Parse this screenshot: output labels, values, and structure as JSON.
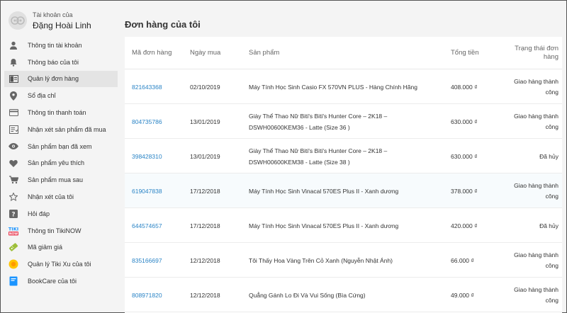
{
  "account": {
    "subtitle": "Tài khoản của",
    "name": "Đặng Hoài Linh"
  },
  "menu": [
    {
      "label": "Thông tin tài khoản",
      "icon": "user-icon"
    },
    {
      "label": "Thông báo của tôi",
      "icon": "bell-icon"
    },
    {
      "label": "Quản lý đơn hàng",
      "icon": "orders-icon",
      "active": true
    },
    {
      "label": "Sổ địa chỉ",
      "icon": "location-pin-icon"
    },
    {
      "label": "Thông tin thanh toán",
      "icon": "credit-card-icon"
    },
    {
      "label": "Nhận xét sản phẩm đã mua",
      "icon": "review-list-icon"
    },
    {
      "label": "Sản phẩm bạn đã xem",
      "icon": "eye-icon"
    },
    {
      "label": "Sản phẩm yêu thích",
      "icon": "heart-icon"
    },
    {
      "label": "Sản phẩm mua sau",
      "icon": "cart-icon"
    },
    {
      "label": "Nhận xét của tôi",
      "icon": "star-icon"
    },
    {
      "label": "Hỏi đáp",
      "icon": "question-icon"
    },
    {
      "label": "Thông tin TikiNOW",
      "icon": "tikinow-icon"
    },
    {
      "label": "Mã giảm giá",
      "icon": "coupon-icon"
    },
    {
      "label": "Quản lý Tiki Xu của tôi",
      "icon": "tiki-xu-coin-icon"
    },
    {
      "label": "BookCare của tôi",
      "icon": "bookcare-icon"
    }
  ],
  "page": {
    "title": "Đơn hàng của tôi"
  },
  "table": {
    "headers": {
      "id": "Mã đơn hàng",
      "date": "Ngày mua",
      "product": "Sản phẩm",
      "total": "Tổng tiền",
      "status": "Trạng thái đơn hàng"
    },
    "rows": [
      {
        "id": "821643368",
        "date": "02/10/2019",
        "product": "Máy Tính Học Sinh Casio FX 570VN PLUS - Hàng Chính Hãng",
        "total": "408.000 ₫",
        "status": "Giao hàng thành công"
      },
      {
        "id": "804735786",
        "date": "13/01/2019",
        "product": "Giày Thể Thao Nữ Biti's Biti's Hunter Core – 2K18 – DSWH00600KEM36 - Latte (Size 36 )",
        "total": "630.000 ₫",
        "status": "Giao hàng thành công"
      },
      {
        "id": "398428310",
        "date": "13/01/2019",
        "product": "Giày Thể Thao Nữ Biti's Biti's Hunter Core – 2K18 – DSWH00600KEM38 - Latte (Size 38 )",
        "total": "630.000 ₫",
        "status": "Đã hủy"
      },
      {
        "id": "619047838",
        "date": "17/12/2018",
        "product": "Máy Tính Học Sinh Vinacal 570ES Plus II - Xanh dương",
        "total": "378.000 ₫",
        "status": "Giao hàng thành công"
      },
      {
        "id": "644574657",
        "date": "17/12/2018",
        "product": "Máy Tính Học Sinh Vinacal 570ES Plus II - Xanh dương",
        "total": "420.000 ₫",
        "status": "Đã hủy"
      },
      {
        "id": "835166697",
        "date": "12/12/2018",
        "product": "Tôi Thấy Hoa Vàng Trên Cỏ Xanh (Nguyễn Nhật Ánh)",
        "total": "66.000 ₫",
        "status": "Giao hàng thành công"
      },
      {
        "id": "808971820",
        "date": "12/12/2018",
        "product": "Quẳng Gánh Lo Đi Và Vui Sống (Bìa Cứng)",
        "total": "49.000 ₫",
        "status": "Giao hàng thành công"
      }
    ]
  },
  "colors": {
    "link": "#2a84c6",
    "active_menu_bg": "#e4e4e4",
    "background": "#f4f4f4"
  }
}
